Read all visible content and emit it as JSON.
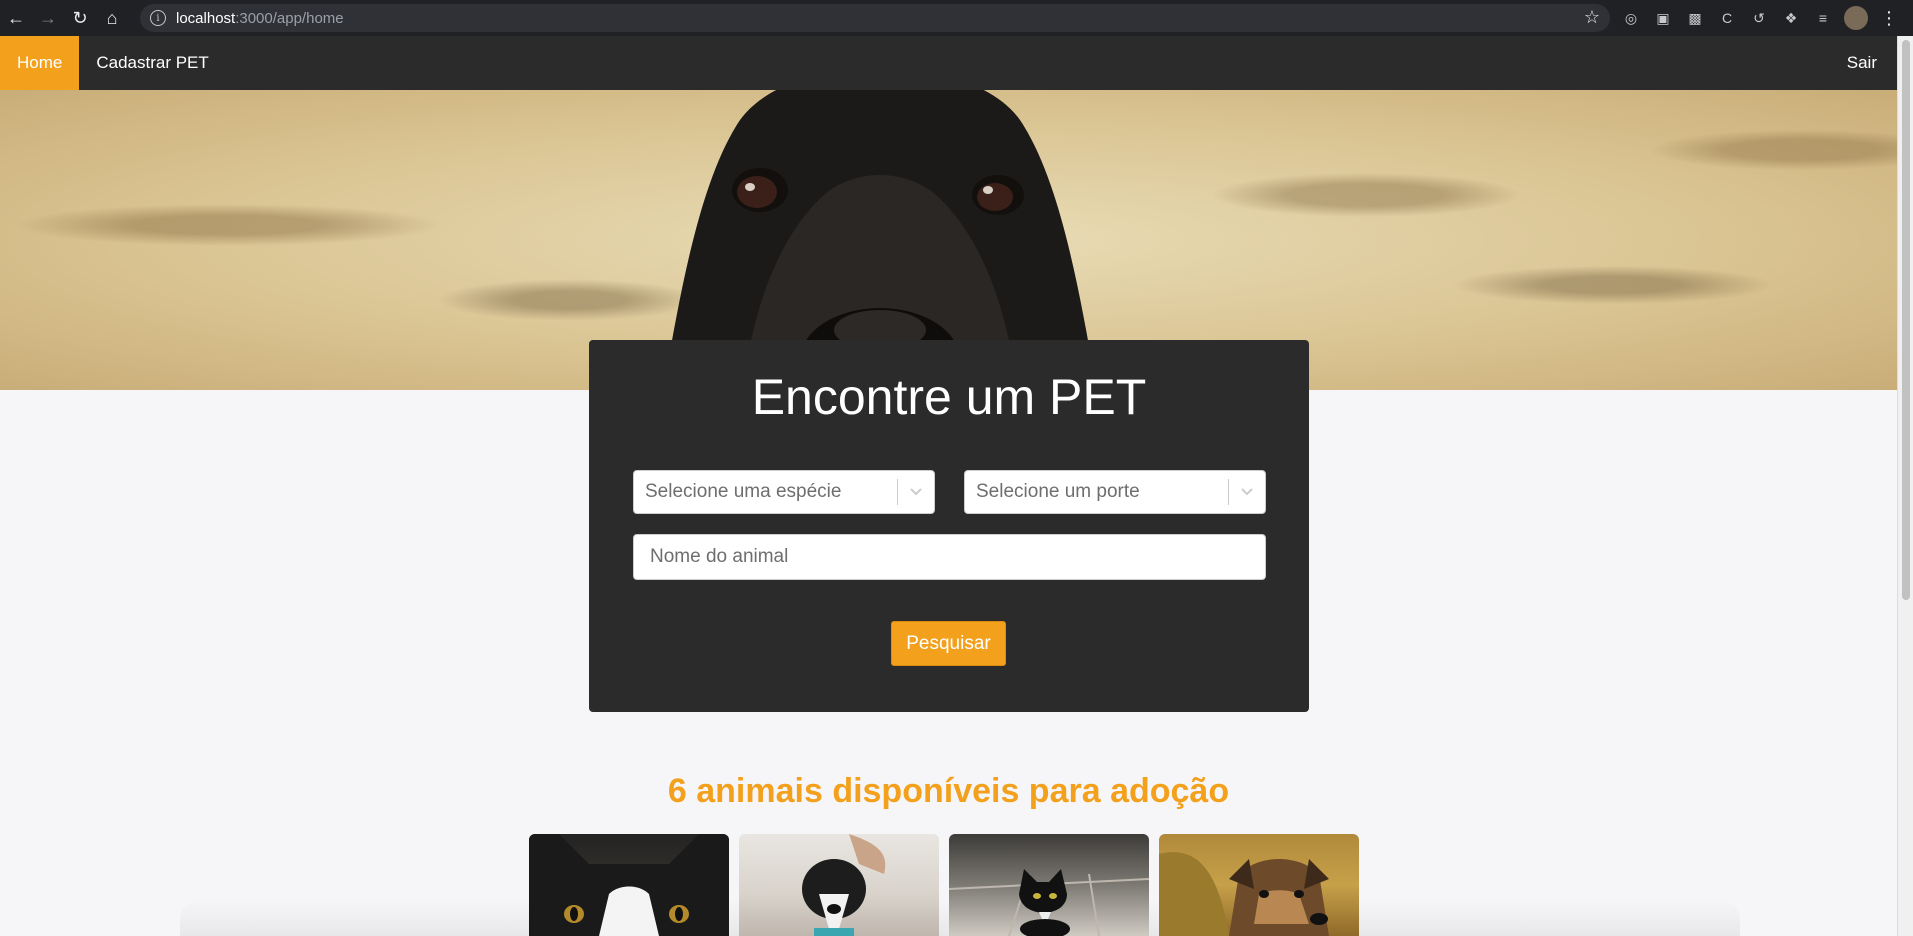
{
  "browser": {
    "url_host": "localhost",
    "url_path": ":3000/app/home"
  },
  "nav": {
    "home": "Home",
    "register": "Cadastrar PET",
    "logout": "Sair"
  },
  "search": {
    "title": "Encontre um PET",
    "species_placeholder": "Selecione uma espécie",
    "size_placeholder": "Selecione um porte",
    "name_placeholder": "Nome do animal",
    "button": "Pesquisar"
  },
  "results": {
    "title": "6 animais disponíveis para adoção"
  },
  "colors": {
    "accent": "#f3a11d",
    "dark": "#2b2b2b"
  }
}
